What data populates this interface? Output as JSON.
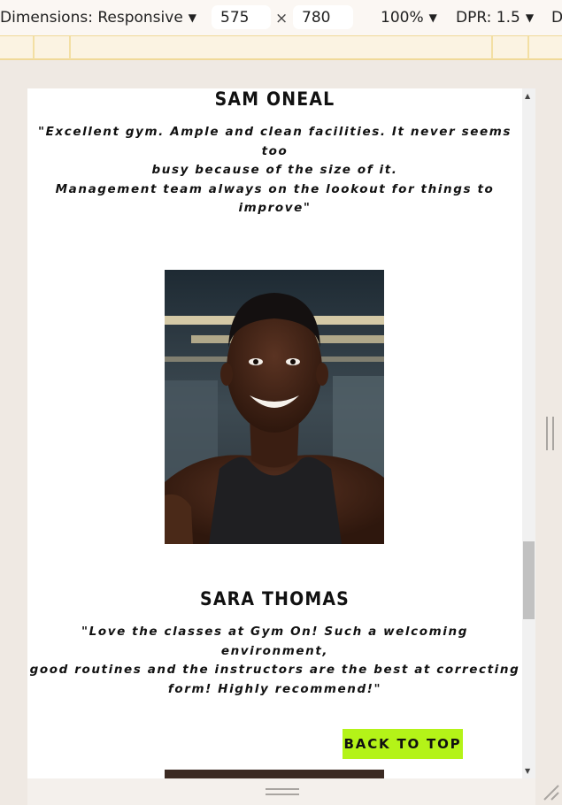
{
  "toolbar": {
    "dimensions_label": "Dimensions: Responsive",
    "width_value": "575",
    "times_symbol": "×",
    "height_value": "780",
    "zoom_label": "100%",
    "dpr_label": "DPR: 1.5",
    "cut_label": "D"
  },
  "page": {
    "testimonial_1": {
      "name": "SAM ONEAL",
      "quote_line_1": "\"Excellent gym. Ample and clean facilities. It never seems too",
      "quote_line_2": "busy because of the size of it.",
      "quote_line_3": "Management team always on the lookout for things to improve\""
    },
    "testimonial_2": {
      "name": "SARA THOMAS",
      "quote_line_1": "\"Love the classes at Gym On! Such a welcoming environment,",
      "quote_line_2": "good routines and the instructors are the best at correcting",
      "quote_line_3": "form! Highly recommend!\""
    },
    "back_to_top_label": "BACK TO TOP"
  },
  "colors": {
    "accent_button": "#b4f318",
    "toolbar_bg": "#fbf7f3",
    "media_bar_border": "#f0d999"
  },
  "icons": [
    "caret-down-icon",
    "scroll-up-icon",
    "scroll-down-icon",
    "resize-handle-icon",
    "corner-resize-icon"
  ]
}
